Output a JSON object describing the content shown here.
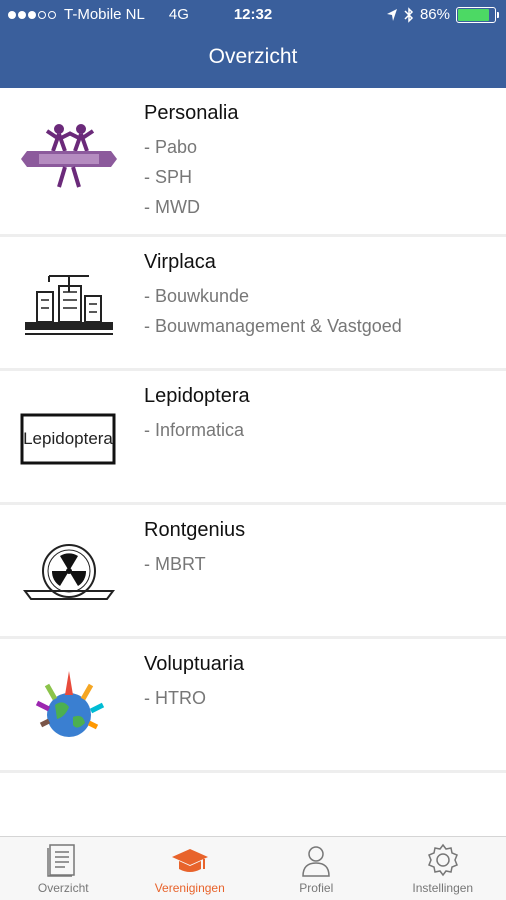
{
  "status": {
    "carrier": "T-Mobile NL",
    "network": "4G",
    "time": "12:32",
    "battery": "86%",
    "battery_level": 0.86
  },
  "header": {
    "title": "Overzicht"
  },
  "associations": [
    {
      "name": "Personalia",
      "subs": [
        "- Pabo",
        "- SPH",
        "- MWD"
      ],
      "logo": "personalia-logo"
    },
    {
      "name": "Virplaca",
      "subs": [
        "- Bouwkunde",
        "- Bouwmanagement & Vastgoed"
      ],
      "logo": "virplaca-logo"
    },
    {
      "name": "Lepidoptera",
      "subs": [
        "- Informatica"
      ],
      "logo": "lepidoptera-logo",
      "logo_text": "Lepidoptera"
    },
    {
      "name": "Rontgenius",
      "subs": [
        "- MBRT"
      ],
      "logo": "rontgenius-logo"
    },
    {
      "name": "Voluptuaria",
      "subs": [
        "- HTRO"
      ],
      "logo": "voluptuaria-logo"
    }
  ],
  "tabs": [
    {
      "label": "Overzicht",
      "icon": "document-icon"
    },
    {
      "label": "Verenigingen",
      "icon": "graduation-cap-icon",
      "active": true
    },
    {
      "label": "Profiel",
      "icon": "person-icon"
    },
    {
      "label": "Instellingen",
      "icon": "gear-icon"
    }
  ],
  "colors": {
    "nav": "#3a5f9c",
    "active_tab": "#e8632b",
    "battery": "#4cd964"
  }
}
